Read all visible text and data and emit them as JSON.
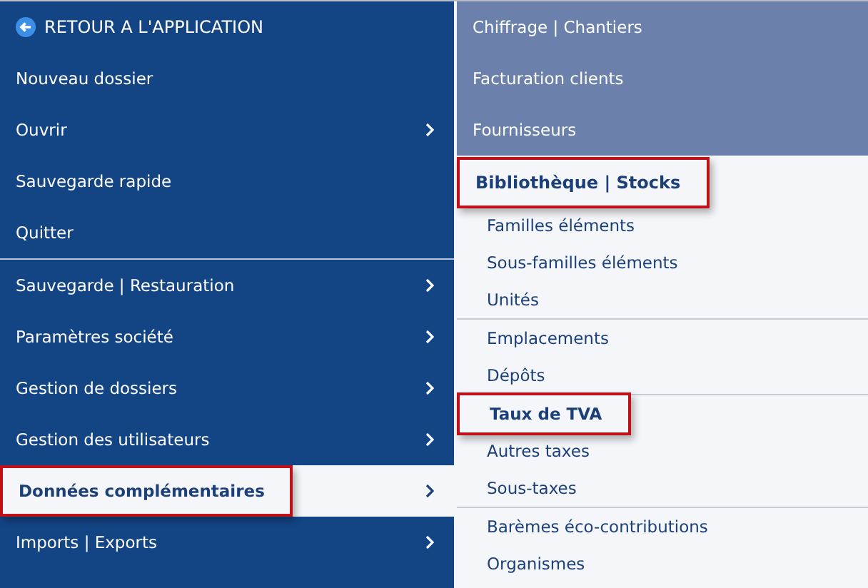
{
  "back_link": {
    "label": "RETOUR A L'APPLICATION"
  },
  "main_menu": [
    {
      "items": [
        {
          "label": "Nouveau dossier",
          "submenu": false,
          "selected": false,
          "highlighted": false
        },
        {
          "label": "Ouvrir",
          "submenu": true,
          "selected": false,
          "highlighted": false
        },
        {
          "label": "Sauvegarde rapide",
          "submenu": false,
          "selected": false,
          "highlighted": false
        },
        {
          "label": "Quitter",
          "submenu": false,
          "selected": false,
          "highlighted": false
        }
      ]
    },
    {
      "items": [
        {
          "label": "Sauvegarde | Restauration",
          "submenu": true,
          "selected": false,
          "highlighted": false
        },
        {
          "label": "Paramètres société",
          "submenu": true,
          "selected": false,
          "highlighted": false
        },
        {
          "label": "Gestion de dossiers",
          "submenu": true,
          "selected": false,
          "highlighted": false
        },
        {
          "label": "Gestion des utilisateurs",
          "submenu": true,
          "selected": false,
          "highlighted": false
        },
        {
          "label": "Données complémentaires",
          "submenu": true,
          "selected": true,
          "highlighted": true
        },
        {
          "label": "Imports | Exports",
          "submenu": true,
          "selected": false,
          "highlighted": false
        }
      ]
    }
  ],
  "quick_links": [
    "Chiffrage | Chantiers",
    "Facturation clients",
    "Fournisseurs"
  ],
  "library": {
    "title": "Bibliothèque | Stocks",
    "highlighted": true,
    "groups": [
      {
        "items": [
          {
            "label": "Familles éléments",
            "selected": false,
            "highlighted": false
          },
          {
            "label": "Sous-familles éléments",
            "selected": false,
            "highlighted": false
          },
          {
            "label": "Unités",
            "selected": false,
            "highlighted": false
          }
        ]
      },
      {
        "items": [
          {
            "label": "Emplacements",
            "selected": false,
            "highlighted": false
          },
          {
            "label": "Dépôts",
            "selected": false,
            "highlighted": false
          }
        ]
      },
      {
        "items": [
          {
            "label": "Taux de TVA",
            "selected": true,
            "highlighted": true
          },
          {
            "label": "Autres taxes",
            "selected": false,
            "highlighted": false
          },
          {
            "label": "Sous-taxes",
            "selected": false,
            "highlighted": false
          }
        ]
      },
      {
        "items": [
          {
            "label": "Barèmes éco-contributions",
            "selected": false,
            "highlighted": false
          },
          {
            "label": "Organismes",
            "selected": false,
            "highlighted": false
          }
        ]
      }
    ]
  }
}
